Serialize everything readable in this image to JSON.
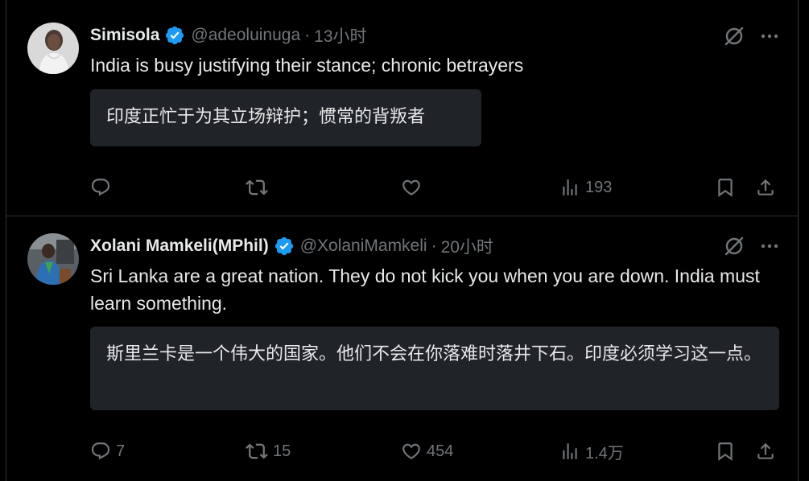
{
  "tweets": [
    {
      "display_name": "Simisola",
      "handle": "@adeoluinuga",
      "separator": "·",
      "time": "13小时",
      "text": "India is busy justifying their stance; chronic betrayers",
      "translation": "印度正忙于为其立场辩护；惯常的背叛者",
      "stats": {
        "replies": "",
        "retweets": "",
        "likes": "",
        "views": "193"
      }
    },
    {
      "display_name": "Xolani Mamkeli(MPhil)",
      "handle": "@XolaniMamkeli",
      "separator": "·",
      "time": "20小时",
      "text": "Sri Lanka  are a great nation. They do not kick you when you are down. India must learn something.",
      "translation": "斯里兰卡是一个伟大的国家。他们不会在你落难时落井下石。印度必须学习这一点。",
      "stats": {
        "replies": "7",
        "retweets": "15",
        "likes": "454",
        "views": "1.4万"
      }
    }
  ],
  "icons": {
    "verified": "verified-badge-icon",
    "grok": "grok-icon",
    "more": "more-icon",
    "reply": "reply-icon",
    "retweet": "retweet-icon",
    "like": "like-icon",
    "views": "views-icon",
    "bookmark": "bookmark-icon",
    "share": "share-icon"
  },
  "colors": {
    "background": "#000000",
    "text_primary": "#e7e9ea",
    "text_secondary": "#71767b",
    "verified": "#1d9bf0",
    "divider": "#2f3336",
    "translation_box": "#202327"
  }
}
